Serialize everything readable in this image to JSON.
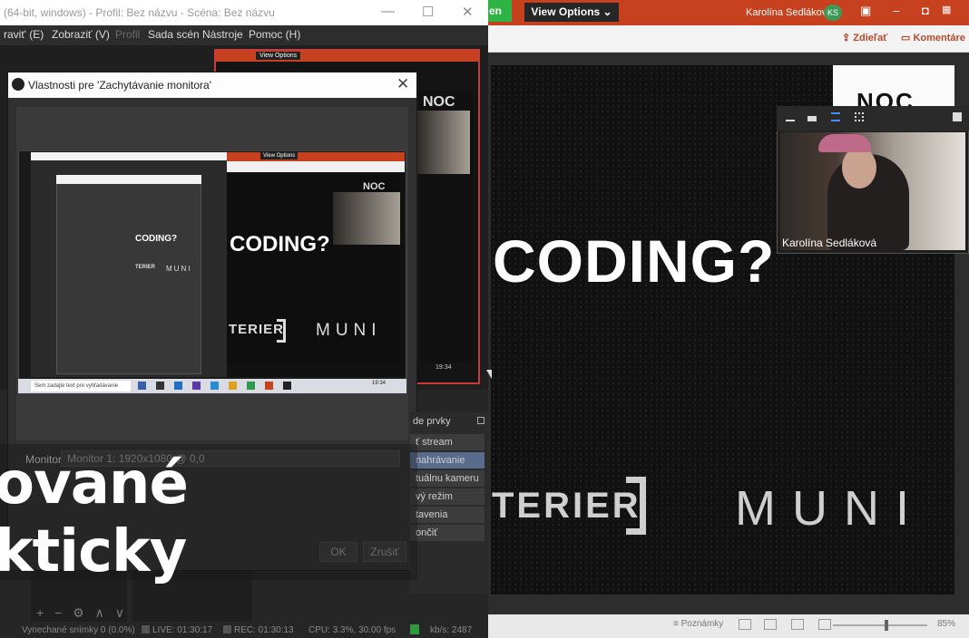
{
  "obs": {
    "title": "(64-bit, windows) - Profil: Bez názvu - Scéna: Bez názvu",
    "menu": [
      "ravit' (E)",
      "Zobraziť (V)",
      "Profil",
      "Sada scén",
      "Nástroje",
      "Pomoc (H)"
    ],
    "dialog": {
      "title": "Vlastnosti pre 'Zachytávanie monitora'",
      "monitor_label": "Monitor",
      "monitor_value": "Monitor 1: 1920x1080 @ 0,0",
      "ok": "OK",
      "cancel": "Zrušiť"
    },
    "controls": {
      "header": "de prvky",
      "items": [
        "ť stream",
        "nahrávanie",
        "tuálnu kameru",
        "vý režim",
        "tavenia",
        "ončiť"
      ]
    },
    "status": {
      "dropped": "Vynechané snímky 0 (0.0%)",
      "live": "LIVE: 01:30:17",
      "rec": "REC: 01:30:13",
      "cpu": "CPU: 3.3%, 30.00 fps",
      "kbs": "kb/s: 2487"
    },
    "preview_time": "19:34",
    "nested": {
      "taskbar_search": "Sem zadajte text pre vyhľadávanie",
      "clock": "19:34",
      "view_options": "View Options",
      "slide_coding": "CODING?",
      "slide_terier": "TERIER",
      "slide_muni": "MUNI",
      "slide_noc": "NOC"
    }
  },
  "ppt": {
    "app_label": "en",
    "view_options": "View Options ⌄",
    "user_name": "Karolína Sedláková",
    "user_initials": "KS",
    "share": "Zdieľať",
    "comments": "Komentáre",
    "notes": "Poznámky",
    "zoom": "85%",
    "slide": {
      "noc": "NOC",
      "coding": "CODING?",
      "terier": "TERIER",
      "muni": "MUNI"
    }
  },
  "zoom_video": {
    "participant_name": "Karolína Sedláková"
  },
  "overlay": {
    "line1": "ované",
    "line2": "kticky"
  },
  "colors": {
    "ppt_accent": "#c8411f",
    "zoom_green": "#2fb344",
    "obs_bg": "#262626",
    "selected_control": "#596c8c"
  }
}
